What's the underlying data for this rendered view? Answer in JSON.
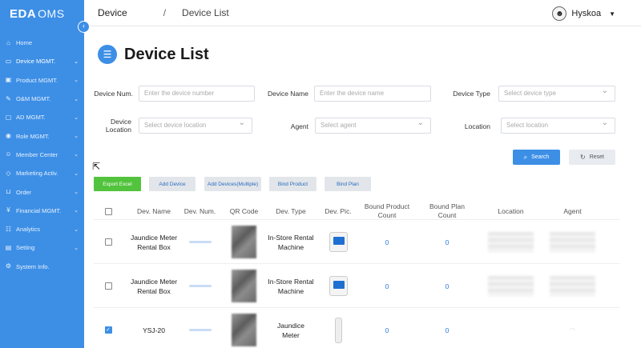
{
  "app": {
    "logo_brand": "EDA",
    "logo_sub": "OMS"
  },
  "sidebar": {
    "items": [
      {
        "label": "Home",
        "icon": "home-icon",
        "glyph": "⌂",
        "chevron": ""
      },
      {
        "label": "Device MGMT.",
        "icon": "monitor-icon",
        "glyph": "▭",
        "chevron": "⌄"
      },
      {
        "label": "Product MGMT.",
        "icon": "box-icon",
        "glyph": "▣",
        "chevron": "⌄"
      },
      {
        "label": "O&M MGMT.",
        "icon": "wrench-icon",
        "glyph": "✎",
        "chevron": "⌄"
      },
      {
        "label": "AD MGMT.",
        "icon": "ad-icon",
        "glyph": "▢",
        "chevron": "⌄"
      },
      {
        "label": "Role MGMT.",
        "icon": "role-icon",
        "glyph": "◉",
        "chevron": "⌄"
      },
      {
        "label": "Member Center",
        "icon": "member-icon",
        "glyph": "☺",
        "chevron": "⌄"
      },
      {
        "label": "Marketing Activ.",
        "icon": "tag-icon",
        "glyph": "◇",
        "chevron": "⌄"
      },
      {
        "label": "Order",
        "icon": "cart-icon",
        "glyph": "⊔",
        "chevron": "⌄"
      },
      {
        "label": "Financial MGMT.",
        "icon": "finance-icon",
        "glyph": "¥",
        "chevron": "⌄"
      },
      {
        "label": "Analytics",
        "icon": "analytics-icon",
        "glyph": "☷",
        "chevron": "⌄"
      },
      {
        "label": "Setting",
        "icon": "setting-icon",
        "glyph": "▤",
        "chevron": "⌄"
      },
      {
        "label": "System Info.",
        "icon": "gear-icon",
        "glyph": "⚙",
        "chevron": ""
      }
    ]
  },
  "header": {
    "crumb1": "Device",
    "separator": "/",
    "crumb2": "Device List",
    "user_name": "Hyskoa"
  },
  "page": {
    "title": "Device List"
  },
  "filters": {
    "device_num": {
      "label": "Device Num.",
      "placeholder": "Enter the device number"
    },
    "device_name": {
      "label": "Device Name",
      "placeholder": "Enter the device name"
    },
    "device_type": {
      "label": "Device Type",
      "placeholder": "Select device type"
    },
    "device_location": {
      "label_line1": "Device",
      "label_line2": "Location",
      "placeholder": "Select device location"
    },
    "agent": {
      "label": "Agent",
      "placeholder": "Select agent"
    },
    "location": {
      "label": "Location",
      "placeholder": "Select location"
    },
    "search_label": "Search",
    "reset_label": "Reset"
  },
  "actions": {
    "export_excel": "Export Excel",
    "add_device": "Add Device",
    "add_devices_multiple": "Add Devices(Multiple)",
    "bind_product": "Bind Product",
    "bind_plan": "Bind Plan"
  },
  "table": {
    "headers": {
      "dev_name": "Dev. Name",
      "dev_num": "Dev. Num.",
      "qr_code": "QR Code",
      "dev_type": "Dev. Type",
      "dev_pic": "Dev. Pic.",
      "bound_product_line1": "Bound Product",
      "bound_product_line2": "Count",
      "bound_plan_line1": "Bound Plan",
      "bound_plan_line2": "Count",
      "location": "Location",
      "agent": "Agent"
    },
    "rows": [
      {
        "name_line1": "Jaundice Meter",
        "name_line2": "Rental Box",
        "type_line1": "In-Store Rental",
        "type_line2": "Machine",
        "bound_product": "0",
        "bound_plan": "0",
        "checked": false
      },
      {
        "name_line1": "Jaundice Meter",
        "name_line2": "Rental Box",
        "type_line1": "In-Store Rental",
        "type_line2": "Machine",
        "bound_product": "0",
        "bound_plan": "0",
        "checked": false
      },
      {
        "name_line1": "YSJ-20",
        "name_line2": "",
        "type_line1": "Jaundice",
        "type_line2": "Meter",
        "bound_product": "0",
        "bound_plan": "0",
        "checked": true
      }
    ]
  },
  "colors": {
    "primary": "#3d8fe6",
    "success": "#52c33c",
    "link": "#2a7ae2"
  }
}
